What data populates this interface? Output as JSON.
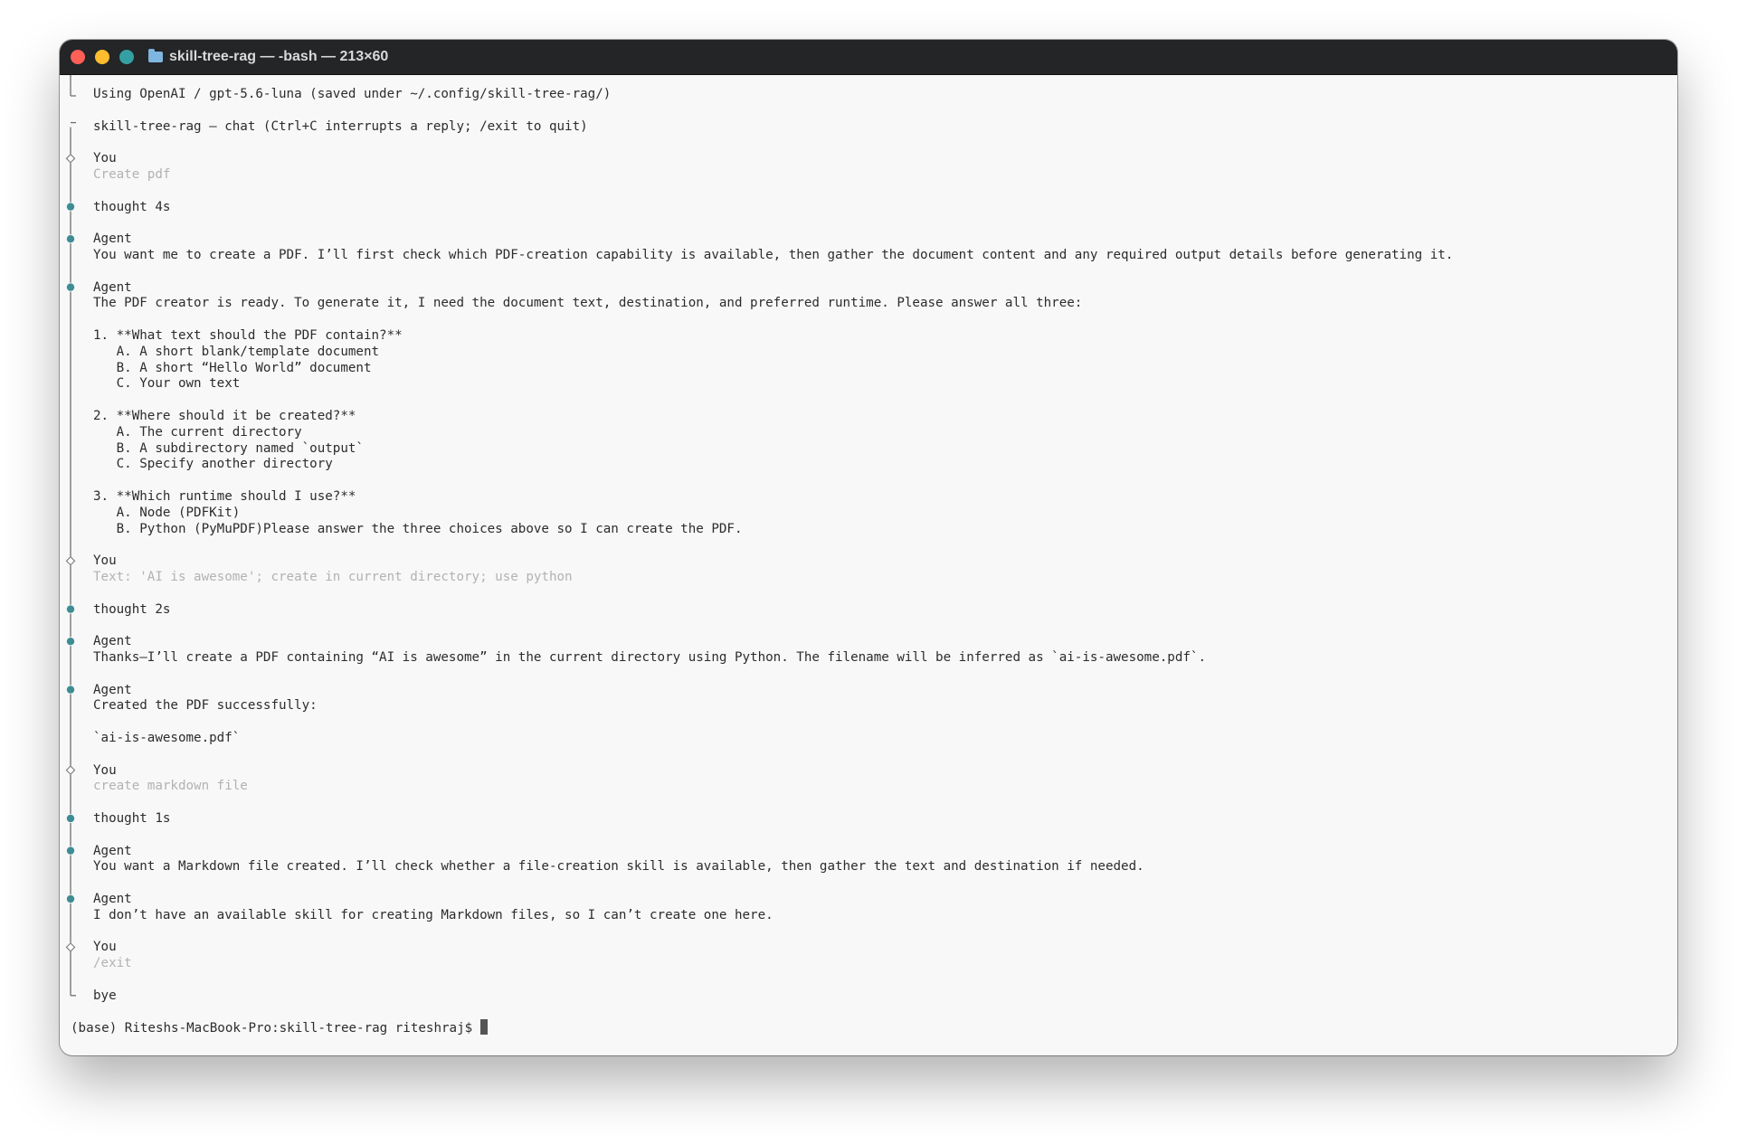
{
  "window": {
    "title": "skill-tree-rag — -bash — 213×60",
    "traffic_lights": {
      "close": "#fe5f57",
      "minimize": "#febc2e",
      "zoom": "#34a0a2"
    },
    "title_icon": "folder-icon"
  },
  "colors": {
    "titlebar": "#232527",
    "terminal_bg": "#f8f8f8",
    "text": "#2c2c2c",
    "dim_text": "#b2b2b2",
    "accent_dot": "#3e8d94"
  },
  "terminal": {
    "header_line": "Using OpenAI / gpt-5.6-luna (saved under ~/.config/skill-tree-rag/)",
    "chat_intro": "skill-tree-rag — chat (Ctrl+C interrupts a reply; /exit to quit)",
    "messages": [
      {
        "role": "You",
        "lines": [
          "Create pdf"
        ]
      },
      {
        "role": "thought 4s"
      },
      {
        "role": "Agent",
        "lines": [
          "You want me to create a PDF. I’ll first check which PDF-creation capability is available, then gather the document content and any required output details before generating it."
        ]
      },
      {
        "role": "Agent",
        "lines": [
          "The PDF creator is ready. To generate it, I need the document text, destination, and preferred runtime. Please answer all three:",
          "",
          "1. **What text should the PDF contain?**",
          "   A. A short blank/template document",
          "   B. A short “Hello World” document",
          "   C. Your own text",
          "",
          "2. **Where should it be created?**",
          "   A. The current directory",
          "   B. A subdirectory named `output`",
          "   C. Specify another directory",
          "",
          "3. **Which runtime should I use?**",
          "   A. Node (PDFKit)",
          "   B. Python (PyMuPDF)Please answer the three choices above so I can create the PDF."
        ]
      },
      {
        "role": "You",
        "lines": [
          "Text: 'AI is awesome'; create in current directory; use python"
        ]
      },
      {
        "role": "thought 2s"
      },
      {
        "role": "Agent",
        "lines": [
          "Thanks—I’ll create a PDF containing “AI is awesome” in the current directory using Python. The filename will be inferred as `ai-is-awesome.pdf`."
        ]
      },
      {
        "role": "Agent",
        "lines": [
          "Created the PDF successfully:",
          "",
          "`ai-is-awesome.pdf`"
        ]
      },
      {
        "role": "You",
        "lines": [
          "create markdown file"
        ]
      },
      {
        "role": "thought 1s"
      },
      {
        "role": "Agent",
        "lines": [
          "You want a Markdown file created. I’ll check whether a file-creation skill is available, then gather the text and destination if needed."
        ]
      },
      {
        "role": "Agent",
        "lines": [
          "I don’t have an available skill for creating Markdown files, so I can’t create one here."
        ]
      },
      {
        "role": "You",
        "lines": [
          "/exit"
        ]
      }
    ],
    "bye": "bye",
    "prompt": "(base) Riteshs-MacBook-Pro:skill-tree-rag riteshraj$ "
  }
}
